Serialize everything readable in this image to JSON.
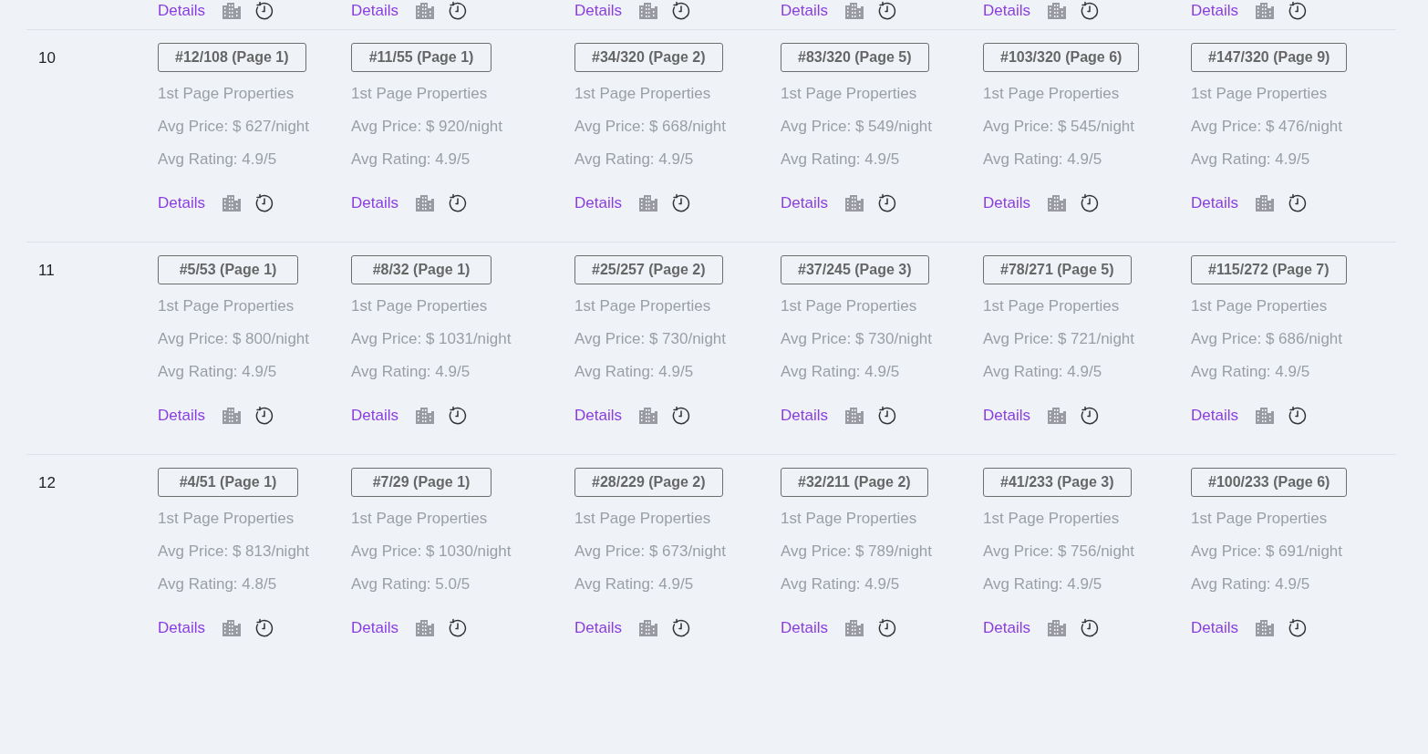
{
  "partial_row": {
    "links": [
      "Details",
      "Details",
      "Details",
      "Details",
      "Details",
      "Details"
    ]
  },
  "rows": [
    {
      "label": "10",
      "cells": [
        {
          "rank": "#12/108 (Page 1)",
          "note": "1st Page Properties",
          "price": "Avg Price: $ 627/night",
          "rating": "Avg Rating: 4.9/5",
          "link": "Details"
        },
        {
          "rank": "#11/55 (Page 1)",
          "note": "1st Page Properties",
          "price": "Avg Price: $ 920/night",
          "rating": "Avg Rating: 4.9/5",
          "link": "Details"
        },
        {
          "rank": "#34/320 (Page 2)",
          "note": "1st Page Properties",
          "price": "Avg Price: $ 668/night",
          "rating": "Avg Rating: 4.9/5",
          "link": "Details"
        },
        {
          "rank": "#83/320 (Page 5)",
          "note": "1st Page Properties",
          "price": "Avg Price: $ 549/night",
          "rating": "Avg Rating: 4.9/5",
          "link": "Details"
        },
        {
          "rank": "#103/320 (Page 6)",
          "note": "1st Page Properties",
          "price": "Avg Price: $ 545/night",
          "rating": "Avg Rating: 4.9/5",
          "link": "Details"
        },
        {
          "rank": "#147/320 (Page 9)",
          "note": "1st Page Properties",
          "price": "Avg Price: $ 476/night",
          "rating": "Avg Rating: 4.9/5",
          "link": "Details"
        }
      ]
    },
    {
      "label": "11",
      "cells": [
        {
          "rank": "#5/53 (Page 1)",
          "note": "1st Page Properties",
          "price": "Avg Price: $ 800/night",
          "rating": "Avg Rating: 4.9/5",
          "link": "Details"
        },
        {
          "rank": "#8/32 (Page 1)",
          "note": "1st Page Properties",
          "price": "Avg Price: $ 1031/night",
          "rating": "Avg Rating: 4.9/5",
          "link": "Details"
        },
        {
          "rank": "#25/257 (Page 2)",
          "note": "1st Page Properties",
          "price": "Avg Price: $ 730/night",
          "rating": "Avg Rating: 4.9/5",
          "link": "Details"
        },
        {
          "rank": "#37/245 (Page 3)",
          "note": "1st Page Properties",
          "price": "Avg Price: $ 730/night",
          "rating": "Avg Rating: 4.9/5",
          "link": "Details"
        },
        {
          "rank": "#78/271 (Page 5)",
          "note": "1st Page Properties",
          "price": "Avg Price: $ 721/night",
          "rating": "Avg Rating: 4.9/5",
          "link": "Details"
        },
        {
          "rank": "#115/272 (Page 7)",
          "note": "1st Page Properties",
          "price": "Avg Price: $ 686/night",
          "rating": "Avg Rating: 4.9/5",
          "link": "Details"
        }
      ]
    },
    {
      "label": "12",
      "cells": [
        {
          "rank": "#4/51 (Page 1)",
          "note": "1st Page Properties",
          "price": "Avg Price: $ 813/night",
          "rating": "Avg Rating: 4.8/5",
          "link": "Details"
        },
        {
          "rank": "#7/29 (Page 1)",
          "note": "1st Page Properties",
          "price": "Avg Price: $ 1030/night",
          "rating": "Avg Rating: 5.0/5",
          "link": "Details"
        },
        {
          "rank": "#28/229 (Page 2)",
          "note": "1st Page Properties",
          "price": "Avg Price: $ 673/night",
          "rating": "Avg Rating: 4.9/5",
          "link": "Details"
        },
        {
          "rank": "#32/211 (Page 2)",
          "note": "1st Page Properties",
          "price": "Avg Price: $ 789/night",
          "rating": "Avg Rating: 4.9/5",
          "link": "Details"
        },
        {
          "rank": "#41/233 (Page 3)",
          "note": "1st Page Properties",
          "price": "Avg Price: $ 756/night",
          "rating": "Avg Rating: 4.9/5",
          "link": "Details"
        },
        {
          "rank": "#100/233 (Page 6)",
          "note": "1st Page Properties",
          "price": "Avg Price: $ 691/night",
          "rating": "Avg Rating: 4.9/5",
          "link": "Details"
        }
      ]
    }
  ]
}
